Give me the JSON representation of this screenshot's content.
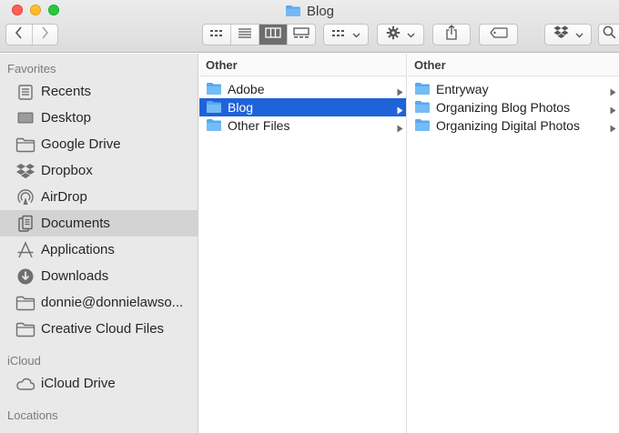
{
  "window": {
    "title": "Blog"
  },
  "toolbar": {
    "back_icon": "chevron-left-icon",
    "forward_icon": "chevron-right-icon",
    "views": [
      "icon-view",
      "list-view",
      "column-view",
      "gallery-view"
    ],
    "active_view": "column-view",
    "group_icon": "group-by-icon",
    "action_icon": "gear-icon",
    "share_icon": "share-icon",
    "tag_icon": "tag-icon",
    "dropbox_icon": "dropbox-icon",
    "search_icon": "search-icon"
  },
  "sidebar": {
    "favorites_header": "Favorites",
    "items": [
      {
        "label": "Recents",
        "icon": "recents-icon"
      },
      {
        "label": "Desktop",
        "icon": "desktop-icon"
      },
      {
        "label": "Google Drive",
        "icon": "folder-icon"
      },
      {
        "label": "Dropbox",
        "icon": "dropbox-icon"
      },
      {
        "label": "AirDrop",
        "icon": "airdrop-icon"
      },
      {
        "label": "Documents",
        "icon": "documents-icon",
        "selected": true
      },
      {
        "label": "Applications",
        "icon": "applications-icon"
      },
      {
        "label": "Downloads",
        "icon": "downloads-icon"
      },
      {
        "label": "donnie@donnielawso...",
        "icon": "folder-icon"
      },
      {
        "label": "Creative Cloud Files",
        "icon": "folder-icon"
      }
    ],
    "icloud_header": "iCloud",
    "icloud_items": [
      {
        "label": "iCloud Drive",
        "icon": "cloud-icon"
      }
    ],
    "locations_header": "Locations"
  },
  "columns": [
    {
      "header": "Other",
      "items": [
        {
          "label": "Adobe",
          "selected": false
        },
        {
          "label": "Blog",
          "selected": true
        },
        {
          "label": "Other Files",
          "selected": false
        }
      ]
    },
    {
      "header": "Other",
      "items": [
        {
          "label": "Entryway",
          "selected": false
        },
        {
          "label": "Organizing Blog Photos",
          "selected": false
        },
        {
          "label": "Organizing Digital Photos",
          "selected": false
        }
      ]
    }
  ],
  "colors": {
    "selection": "#1f63d8",
    "folder": "#5aa8f0",
    "sidebar_bg": "#e9e9e9",
    "sidebar_selected": "#d3d3d3"
  }
}
